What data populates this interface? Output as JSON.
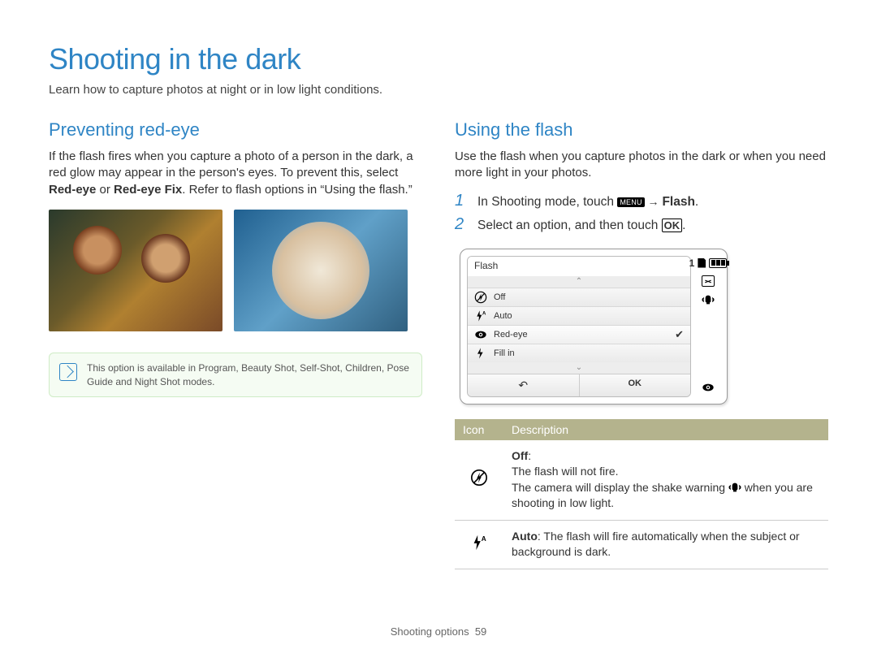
{
  "title": "Shooting in the dark",
  "subtitle": "Learn how to capture photos at night or in low light conditions.",
  "left": {
    "heading": "Preventing red-eye",
    "para_a": "If the flash fires when you capture a photo of a person in the dark, a red glow may appear in the person's eyes. To prevent this, select ",
    "para_b": "Red-eye",
    "para_c": " or ",
    "para_d": "Red-eye Fix",
    "para_e": ". Refer to flash options in “Using the flash.”",
    "note": "This option is available in Program, Beauty Shot, Self-Shot, Children, Pose Guide and Night Shot modes."
  },
  "right": {
    "heading": "Using the flash",
    "para": "Use the flash when you capture photos in the dark or when you need more light in your photos.",
    "step1_a": "In Shooting mode, touch ",
    "step1_menu": "MENU",
    "step1_arrow": " → ",
    "step1_b": "Flash",
    "step1_c": ".",
    "step2_a": "Select an option, and then touch ",
    "step2_ok": "OK",
    "step2_b": "."
  },
  "device": {
    "title": "Flash",
    "items": [
      {
        "label": "Off",
        "icon": "flash-off"
      },
      {
        "label": "Auto",
        "icon": "flash-auto"
      },
      {
        "label": "Red-eye",
        "icon": "red-eye",
        "selected": true
      },
      {
        "label": "Fill in",
        "icon": "flash-fillin"
      }
    ],
    "ok": "OK",
    "count": "1"
  },
  "table": {
    "hdr_icon": "Icon",
    "hdr_desc": "Description",
    "rows": [
      {
        "icon": "flash-off",
        "title": "Off",
        "line1": "The flash will not fire.",
        "line2a": "The camera will display the shake warning ",
        "shake": true,
        "line2b": " when you are shooting in low light."
      },
      {
        "icon": "flash-auto",
        "title": "Auto",
        "desc": ": The flash will fire automatically when the subject or background is dark."
      }
    ]
  },
  "footer_a": "Shooting options",
  "footer_b": "59"
}
